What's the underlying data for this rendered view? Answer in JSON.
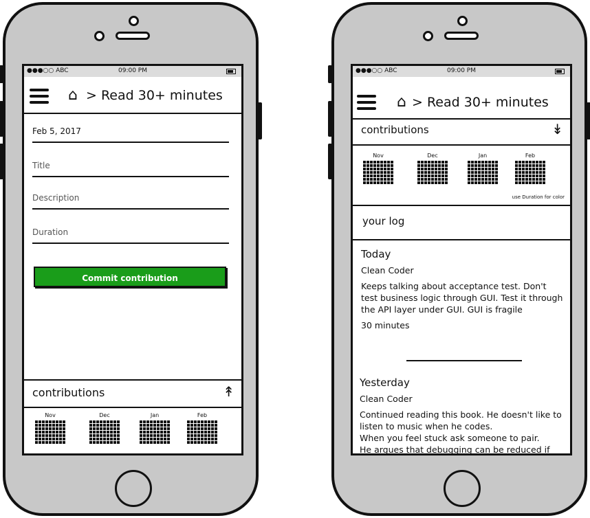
{
  "left_screen": {
    "status": {
      "carrier": "●●●○○ ABC",
      "time": "09:00 PM"
    },
    "header": {
      "home_icon": "house-icon",
      "title": "> Read 30+ minutes"
    },
    "form": {
      "date": "Feb 5, 2017",
      "title_placeholder": "Title",
      "description_placeholder": "Description",
      "duration_placeholder": "Duration",
      "commit_label": "Commit contribution"
    },
    "contributions": {
      "label": "contributions",
      "toggle_icon": "chevron-up-double-icon",
      "months": [
        "Nov",
        "Dec",
        "Jan",
        "Feb"
      ]
    }
  },
  "right_screen": {
    "status": {
      "carrier": "●●●○○ ABC",
      "time": "09:00 PM"
    },
    "header": {
      "home_icon": "house-icon",
      "title": "> Read 30+ minutes"
    },
    "contributions": {
      "label": "contributions",
      "toggle_icon": "chevron-down-double-icon",
      "months": [
        "Nov",
        "Dec",
        "Jan",
        "Feb"
      ],
      "note": "use Duration for color"
    },
    "log": {
      "label": "your log",
      "entries": [
        {
          "day": "Today",
          "book": "Clean Coder",
          "text": "Keeps talking about acceptance test. Don't test business logic through GUI. Test it through the API layer under GUI. GUI is fragile",
          "duration": "30 minutes"
        },
        {
          "day": "Yesterday",
          "book": "Clean Coder",
          "text": "Continued reading this book. He doesn't like to listen to music when he codes.",
          "text2": "When you feel stuck ask someone to pair.",
          "text3": "He argues that debugging can be reduced if"
        }
      ]
    }
  }
}
